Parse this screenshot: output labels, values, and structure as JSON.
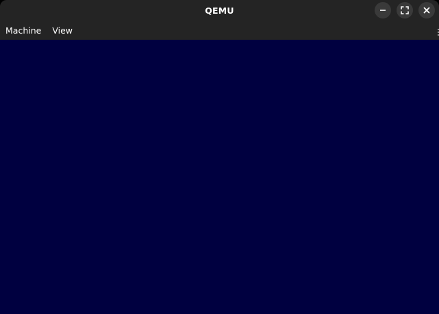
{
  "window": {
    "title": "QEMU"
  },
  "window_controls": {
    "minimize_icon": "minimize-icon",
    "maximize_icon": "maximize-icon",
    "close_icon": "close-icon"
  },
  "menubar": {
    "items": [
      {
        "label": "Machine"
      },
      {
        "label": "View"
      }
    ]
  },
  "display": {
    "background_color": "#000040"
  }
}
